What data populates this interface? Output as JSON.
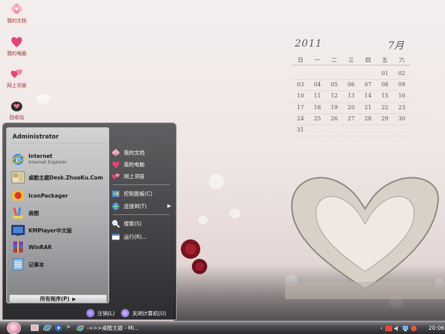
{
  "desktop": {
    "icons": [
      {
        "label": "我的文档",
        "icon": "pink-flower-icon"
      },
      {
        "label": "我的电脑",
        "icon": "pink-heart-icon"
      },
      {
        "label": "网上邻居",
        "icon": "pink-hearts-icon"
      },
      {
        "label": "回收站",
        "icon": "heart-bin-icon"
      }
    ]
  },
  "calendar": {
    "year": "2011",
    "month": "7月",
    "weekdays": [
      "日",
      "一",
      "二",
      "三",
      "四",
      "五",
      "六"
    ],
    "rows": [
      [
        "",
        "",
        "",
        "",
        "",
        "01",
        "02"
      ],
      [
        "03",
        "04",
        "05",
        "06",
        "07",
        "08",
        "09"
      ],
      [
        "10",
        "11",
        "12",
        "13",
        "14",
        "15",
        "16"
      ],
      [
        "17",
        "18",
        "19",
        "20",
        "21",
        "22",
        "23"
      ],
      [
        "24",
        "25",
        "26",
        "27",
        "28",
        "29",
        "30"
      ],
      [
        "31",
        "",
        "",
        "",
        "",
        "",
        ""
      ]
    ]
  },
  "start_menu": {
    "user": "Administrator",
    "programs": [
      {
        "name": "Internet",
        "sub": "Internet Explorer",
        "icon": "internet-explorer-icon"
      },
      {
        "name": "桌酷主题Desk.ZhuoKu.Com",
        "sub": "",
        "icon": "zhuoku-icon"
      },
      {
        "name": "IconPackager",
        "sub": "",
        "icon": "iconpackager-icon"
      },
      {
        "name": "画图",
        "sub": "",
        "icon": "paint-icon"
      },
      {
        "name": "KMPlayer中文版",
        "sub": "",
        "icon": "kmplayer-icon"
      },
      {
        "name": "WinRAR",
        "sub": "",
        "icon": "winrar-icon"
      },
      {
        "name": "记事本",
        "sub": "",
        "icon": "notepad-icon"
      }
    ],
    "all_programs": "所有程序(P)",
    "places": [
      {
        "label": "我的文档",
        "icon": "pink-flower-icon"
      },
      {
        "label": "我的电脑",
        "icon": "pink-heart-icon"
      },
      {
        "label": "网上邻居",
        "icon": "pink-hearts-icon"
      }
    ],
    "tools": [
      {
        "label": "控制面板(C)",
        "icon": "control-panel-icon"
      },
      {
        "label": "连接到(T)",
        "icon": "connect-icon"
      }
    ],
    "actions": [
      {
        "label": "搜索(S)",
        "icon": "search-icon"
      },
      {
        "label": "运行(R)...",
        "icon": "run-icon"
      }
    ],
    "logoff": "注销(L)",
    "shutdown": "关闭计算机(U)"
  },
  "taskbar": {
    "overflow": ">",
    "task_label": "-=>>桌酷主题 - Mi...",
    "clock": "20:06"
  },
  "colors": {
    "desktop_label": "#a03030",
    "accent_pink": "#e06a8a"
  }
}
